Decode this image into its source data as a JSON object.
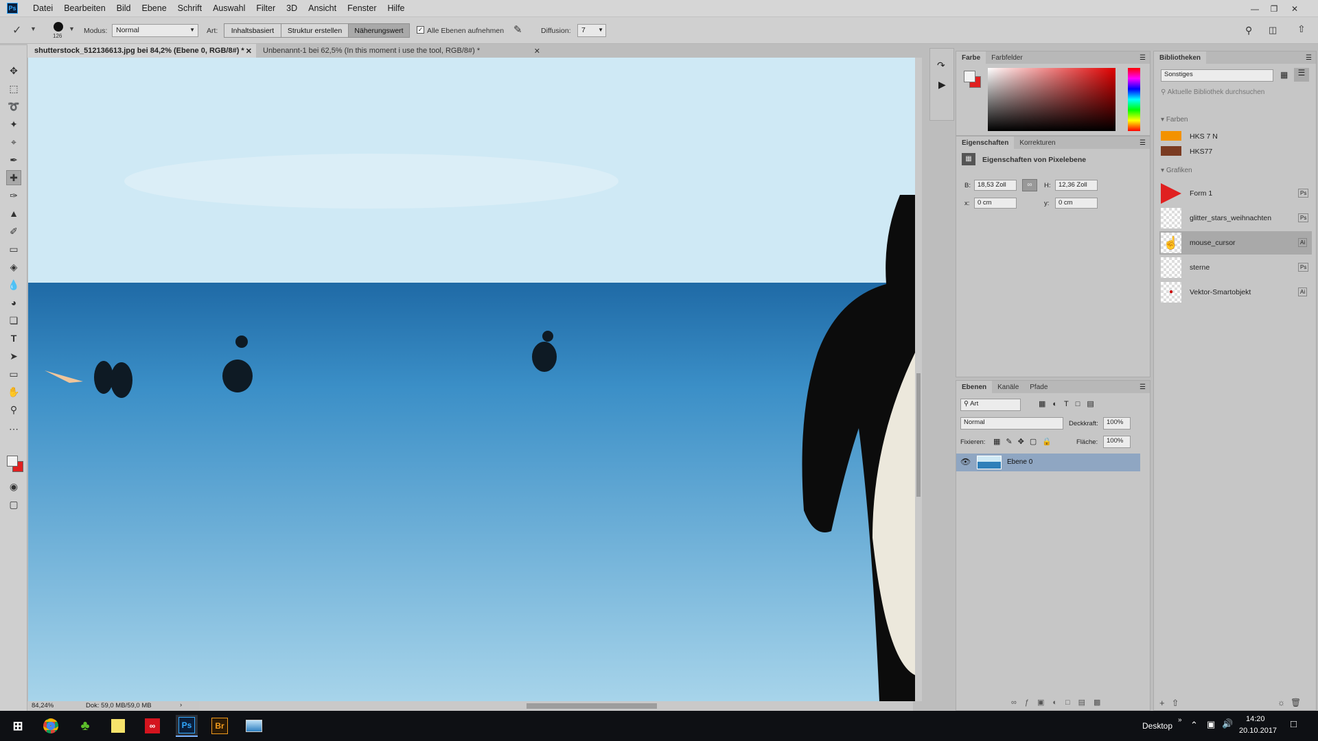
{
  "menu": {
    "logo": "Ps",
    "items": [
      "Datei",
      "Bearbeiten",
      "Bild",
      "Ebene",
      "Schrift",
      "Auswahl",
      "Filter",
      "3D",
      "Ansicht",
      "Fenster",
      "Hilfe"
    ]
  },
  "options": {
    "brush_size": "126",
    "modus_label": "Modus:",
    "modus_value": "Normal",
    "art_label": "Art:",
    "btn_content": "Inhaltsbasiert",
    "btn_structure": "Struktur erstellen",
    "btn_approx": "Näherungswert",
    "all_layers": "Alle Ebenen aufnehmen",
    "diffusion_label": "Diffusion:",
    "diffusion_value": "7"
  },
  "tabs": [
    {
      "label": "shutterstock_512136613.jpg bei 84,2% (Ebene 0, RGB/8#) *"
    },
    {
      "label": "Unbenannt-1 bei 62,5% (In this moment i use the tool, RGB/8#) *"
    }
  ],
  "status": {
    "zoom": "84,24%",
    "doc": "Dok: 59,0 MB/59,0 MB"
  },
  "color_panel": {
    "tab_active": "Farbe",
    "tab_other": "Farbfelder",
    "fg_color": "#f2f2f2",
    "bg_color": "#e02020"
  },
  "properties": {
    "tab_active": "Eigenschaften",
    "tab_other": "Korrekturen",
    "title": "Eigenschaften von Pixelebene",
    "b_label": "B:",
    "b_value": "18,53 Zoll",
    "h_label": "H:",
    "h_value": "12,36 Zoll",
    "x_label": "x:",
    "x_value": "0 cm",
    "y_label": "y:",
    "y_value": "0 cm"
  },
  "layers": {
    "tab_active": "Ebenen",
    "tab_channels": "Kanäle",
    "tab_paths": "Pfade",
    "filter": "Art",
    "blend": "Normal",
    "opacity_label": "Deckkraft:",
    "opacity": "100%",
    "lock_label": "Fixieren:",
    "fill_label": "Fläche:",
    "fill": "100%",
    "items": [
      {
        "name": "Ebene 0"
      }
    ]
  },
  "libraries": {
    "tab": "Bibliotheken",
    "library": "Sonstiges",
    "search_placeholder": "Aktuelle Bibliothek durchsuchen",
    "colors_header": "Farben",
    "colors": [
      {
        "name": "HKS 7 N",
        "hex": "#f39200"
      },
      {
        "name": "HKS77",
        "hex": "#7a3b22"
      }
    ],
    "graphics_header": "Grafiken",
    "graphics": [
      {
        "name": "Form 1",
        "badge": "Ps"
      },
      {
        "name": "glitter_stars_weihnachten",
        "badge": "Ps"
      },
      {
        "name": "mouse_cursor",
        "badge": "Ai"
      },
      {
        "name": "sterne",
        "badge": "Ps"
      },
      {
        "name": "Vektor-Smartobjekt",
        "badge": "Ai"
      }
    ]
  },
  "taskbar": {
    "desktop_label": "Desktop",
    "time": "14:20",
    "date": "20.10.2017",
    "app_ps": "Ps",
    "app_br": "Br"
  }
}
